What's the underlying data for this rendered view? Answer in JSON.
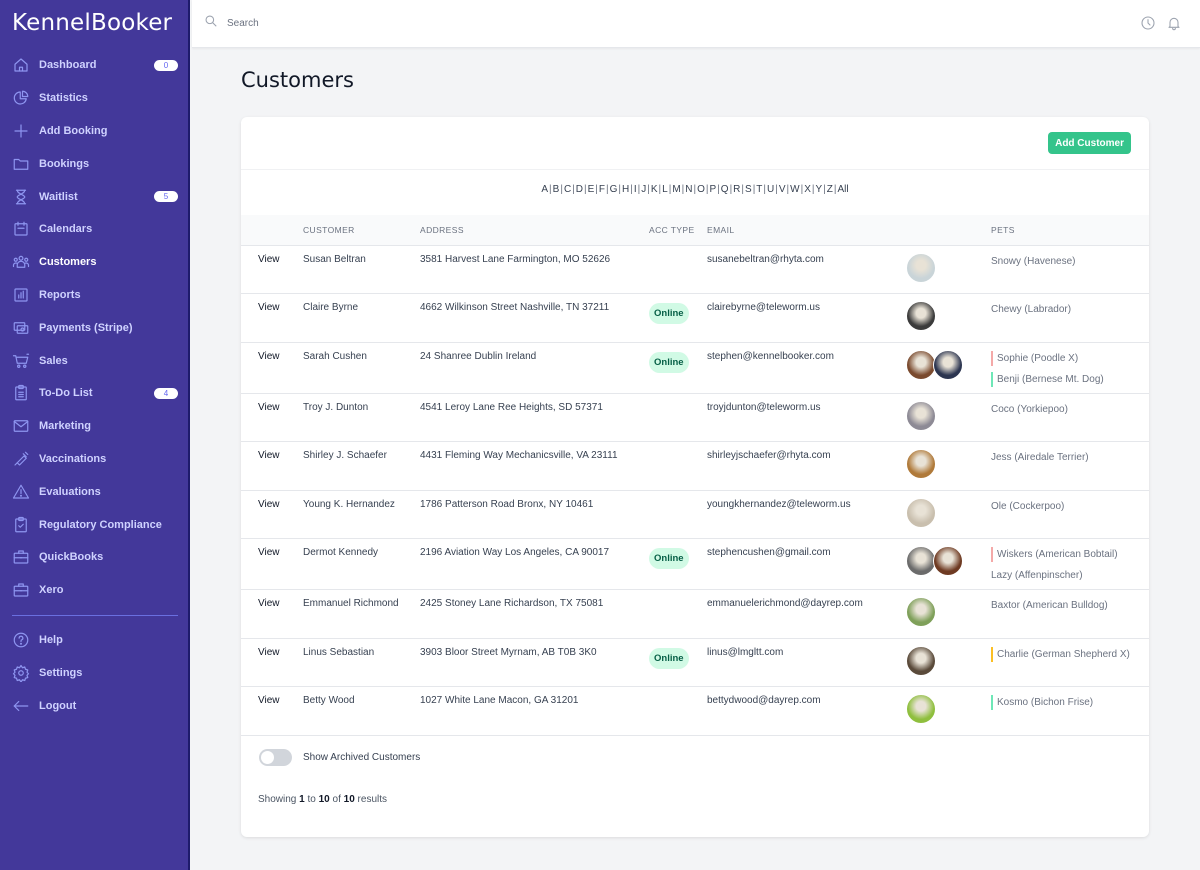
{
  "app": {
    "name": "KennelBooker"
  },
  "sidebar": {
    "items": [
      {
        "label": "Dashboard",
        "icon": "home-icon",
        "badge": "0"
      },
      {
        "label": "Statistics",
        "icon": "pie-chart-icon"
      },
      {
        "label": "Add Booking",
        "icon": "plus-icon"
      },
      {
        "label": "Bookings",
        "icon": "folder-icon"
      },
      {
        "label": "Waitlist",
        "icon": "hourglass-icon",
        "badge": "5"
      },
      {
        "label": "Calendars",
        "icon": "calendar-icon"
      },
      {
        "label": "Customers",
        "icon": "users-icon",
        "active": true
      },
      {
        "label": "Reports",
        "icon": "bar-chart-icon"
      },
      {
        "label": "Payments (Stripe)",
        "icon": "cash-icon"
      },
      {
        "label": "Sales",
        "icon": "cart-icon"
      },
      {
        "label": "To-Do List",
        "icon": "clipboard-list-icon",
        "badge": "4"
      },
      {
        "label": "Marketing",
        "icon": "mail-icon"
      },
      {
        "label": "Vaccinations",
        "icon": "syringe-icon"
      },
      {
        "label": "Evaluations",
        "icon": "warning-icon"
      },
      {
        "label": "Regulatory Compliance",
        "icon": "clipboard-check-icon"
      },
      {
        "label": "QuickBooks",
        "icon": "briefcase-icon"
      },
      {
        "label": "Xero",
        "icon": "briefcase-icon"
      }
    ],
    "bottom_items": [
      {
        "label": "Help",
        "icon": "help-circle-icon"
      },
      {
        "label": "Settings",
        "icon": "gear-icon"
      },
      {
        "label": "Logout",
        "icon": "arrow-left-icon"
      }
    ]
  },
  "header": {
    "search_placeholder": "Search",
    "icons": [
      "clock-icon",
      "bell-icon"
    ]
  },
  "page": {
    "title": "Customers",
    "add_button": "Add Customer",
    "alphabet": [
      "A",
      "B",
      "C",
      "D",
      "E",
      "F",
      "G",
      "H",
      "I",
      "J",
      "K",
      "L",
      "M",
      "N",
      "O",
      "P",
      "Q",
      "R",
      "S",
      "T",
      "U",
      "V",
      "W",
      "X",
      "Y",
      "Z",
      "All"
    ],
    "columns": [
      "",
      "Customer",
      "Address",
      "Acc Type",
      "Email",
      "",
      "Pets"
    ],
    "rows": [
      {
        "view": "View",
        "customer": "Susan Beltran",
        "address": "3581 Harvest Lane Farmington, MO 52626",
        "acc_type": "",
        "email": "susanebeltran@rhyta.com",
        "photos": [
          "#c9d4d8"
        ],
        "pets": [
          {
            "name": "Snowy (Havenese)",
            "flag": ""
          }
        ]
      },
      {
        "view": "View",
        "customer": "Claire Byrne",
        "address": "4662 Wilkinson Street Nashville, TN 37211",
        "acc_type": "Online",
        "email": "clairebyrne@teleworm.us",
        "photos": [
          "#3b3b3b"
        ],
        "pets": [
          {
            "name": "Chewy (Labrador)",
            "flag": ""
          }
        ]
      },
      {
        "view": "View",
        "customer": "Sarah Cushen",
        "address": "24 Shanree Dublin Ireland",
        "acc_type": "Online",
        "email": "stephen@kennelbooker.com",
        "photos": [
          "#7a4a2e",
          "#2c3550"
        ],
        "pets": [
          {
            "name": "Sophie (Poodle X)",
            "flag": "#f4a9a8"
          },
          {
            "name": "Benji (Bernese Mt. Dog)",
            "flag": "#6ee7b7"
          }
        ]
      },
      {
        "view": "View",
        "customer": "Troy J. Dunton",
        "address": "4541 Leroy Lane Ree Heights, SD 57371",
        "acc_type": "",
        "email": "troyjdunton@teleworm.us",
        "photos": [
          "#8d8a95"
        ],
        "pets": [
          {
            "name": "Coco (Yorkiepoo)",
            "flag": ""
          }
        ]
      },
      {
        "view": "View",
        "customer": "Shirley J. Schaefer",
        "address": "4431 Fleming Way Mechanicsville, VA 23111",
        "acc_type": "",
        "email": "shirleyjschaefer@rhyta.com",
        "photos": [
          "#b07a3a"
        ],
        "pets": [
          {
            "name": "Jess (Airedale Terrier)",
            "flag": ""
          }
        ]
      },
      {
        "view": "View",
        "customer": "Young K. Hernandez",
        "address": "1786 Patterson Road Bronx, NY 10461",
        "acc_type": "",
        "email": "youngkhernandez@teleworm.us",
        "photos": [
          "#c9bfae"
        ],
        "pets": [
          {
            "name": "Ole (Cockerpoo)",
            "flag": ""
          }
        ]
      },
      {
        "view": "View",
        "customer": "Dermot Kennedy",
        "address": "2196 Aviation Way Los Angeles, CA 90017",
        "acc_type": "Online",
        "email": "stephencushen@gmail.com",
        "photos": [
          "#6b6b6b",
          "#6e3a22"
        ],
        "pets": [
          {
            "name": "Wiskers (American Bobtail)",
            "flag": "#f4a9a8"
          },
          {
            "name": "Lazy (Affenpinscher)",
            "flag": ""
          }
        ]
      },
      {
        "view": "View",
        "customer": "Emmanuel Richmond",
        "address": "2425 Stoney Lane Richardson, TX 75081",
        "acc_type": "",
        "email": "emmanuelerichmond@dayrep.com",
        "photos": [
          "#7fa05a"
        ],
        "pets": [
          {
            "name": "Baxtor (American Bulldog)",
            "flag": ""
          }
        ]
      },
      {
        "view": "View",
        "customer": "Linus Sebastian",
        "address": "3903 Bloor Street Myrnam, AB T0B 3K0",
        "acc_type": "Online",
        "email": "linus@lmgltt.com",
        "photos": [
          "#5a4a3a"
        ],
        "pets": [
          {
            "name": "Charlie (German Shepherd X)",
            "flag": "#fbbf24"
          }
        ]
      },
      {
        "view": "View",
        "customer": "Betty Wood",
        "address": "1027 White Lane Macon, GA 31201",
        "acc_type": "",
        "email": "bettydwood@dayrep.com",
        "photos": [
          "#8fbf3e"
        ],
        "pets": [
          {
            "name": "Kosmo (Bichon Frise)",
            "flag": "#6ee7b7"
          }
        ]
      }
    ],
    "archived_toggle": {
      "label": "Show Archived Customers",
      "on": false
    },
    "pagination": {
      "prefix": "Showing",
      "from": "1",
      "to_word": "to",
      "to": "10",
      "of_word": "of",
      "total": "10",
      "suffix": "results"
    }
  },
  "colors": {
    "sidebar": "#43389a",
    "accent": "#34c48b",
    "online_bg": "#d1fae5",
    "online_text": "#065f46"
  }
}
